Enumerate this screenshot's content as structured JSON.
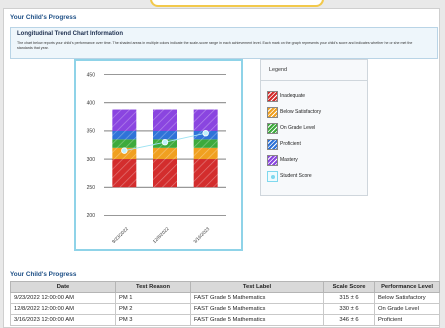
{
  "page": {
    "section_title": "Your Child's Progress"
  },
  "info": {
    "title": "Longitudinal Trend Chart Information",
    "body": "The chart below reports your child's performance over time. The shaded areas in multiple colors indicate the scale-score range in each achievement level. Each mark on the graph represents your child's score and indicates whether he or she met the standards that year."
  },
  "chart_data": {
    "type": "line",
    "y_ticks": [
      "450",
      "400",
      "350",
      "300",
      "250",
      "200"
    ],
    "ylim": [
      190,
      460
    ],
    "categories": [
      "9/23/2022",
      "12/8/2022",
      "3/16/2023"
    ],
    "levels": [
      {
        "name": "Inadequate",
        "color": "#d32d2d",
        "from": 250,
        "to": 300
      },
      {
        "name": "Below Satisfactory",
        "color": "#f0a020",
        "from": 300,
        "to": 320
      },
      {
        "name": "On Grade Level",
        "color": "#3daa3c",
        "from": 320,
        "to": 335
      },
      {
        "name": "Proficient",
        "color": "#2f73d8",
        "from": 335,
        "to": 350
      },
      {
        "name": "Mastery",
        "color": "#8a45e0",
        "from": 350,
        "to": 388
      }
    ],
    "series": [
      {
        "values": [
          315,
          330,
          346
        ]
      }
    ]
  },
  "legend": {
    "title": "Legend",
    "items": [
      {
        "label": "Inadequate",
        "color": "#d32d2d"
      },
      {
        "label": "Below Satisfactory",
        "color": "#f0a020"
      },
      {
        "label": "On Grade Level",
        "color": "#3daa3c"
      },
      {
        "label": "Proficient",
        "color": "#2f73d8"
      },
      {
        "label": "Mastery",
        "color": "#8a45e0"
      },
      {
        "label": "Student Score",
        "color": "#7fd8ee"
      }
    ]
  },
  "table": {
    "title": "Your Child's Progress",
    "columns": [
      "Date",
      "Test Reason",
      "Test Label",
      "Scale Score",
      "Performance Level"
    ],
    "rows": [
      [
        "9/23/2022 12:00:00 AM",
        "PM 1",
        "FAST Grade 5 Mathematics",
        "315 ± 6",
        "Below Satisfactory"
      ],
      [
        "12/8/2022 12:00:00 AM",
        "PM 2",
        "FAST Grade 5 Mathematics",
        "330 ± 6",
        "On Grade Level"
      ],
      [
        "3/16/2023 12:00:00 AM",
        "PM 3",
        "FAST Grade 5 Mathematics",
        "346 ± 6",
        "Proficient"
      ]
    ]
  }
}
